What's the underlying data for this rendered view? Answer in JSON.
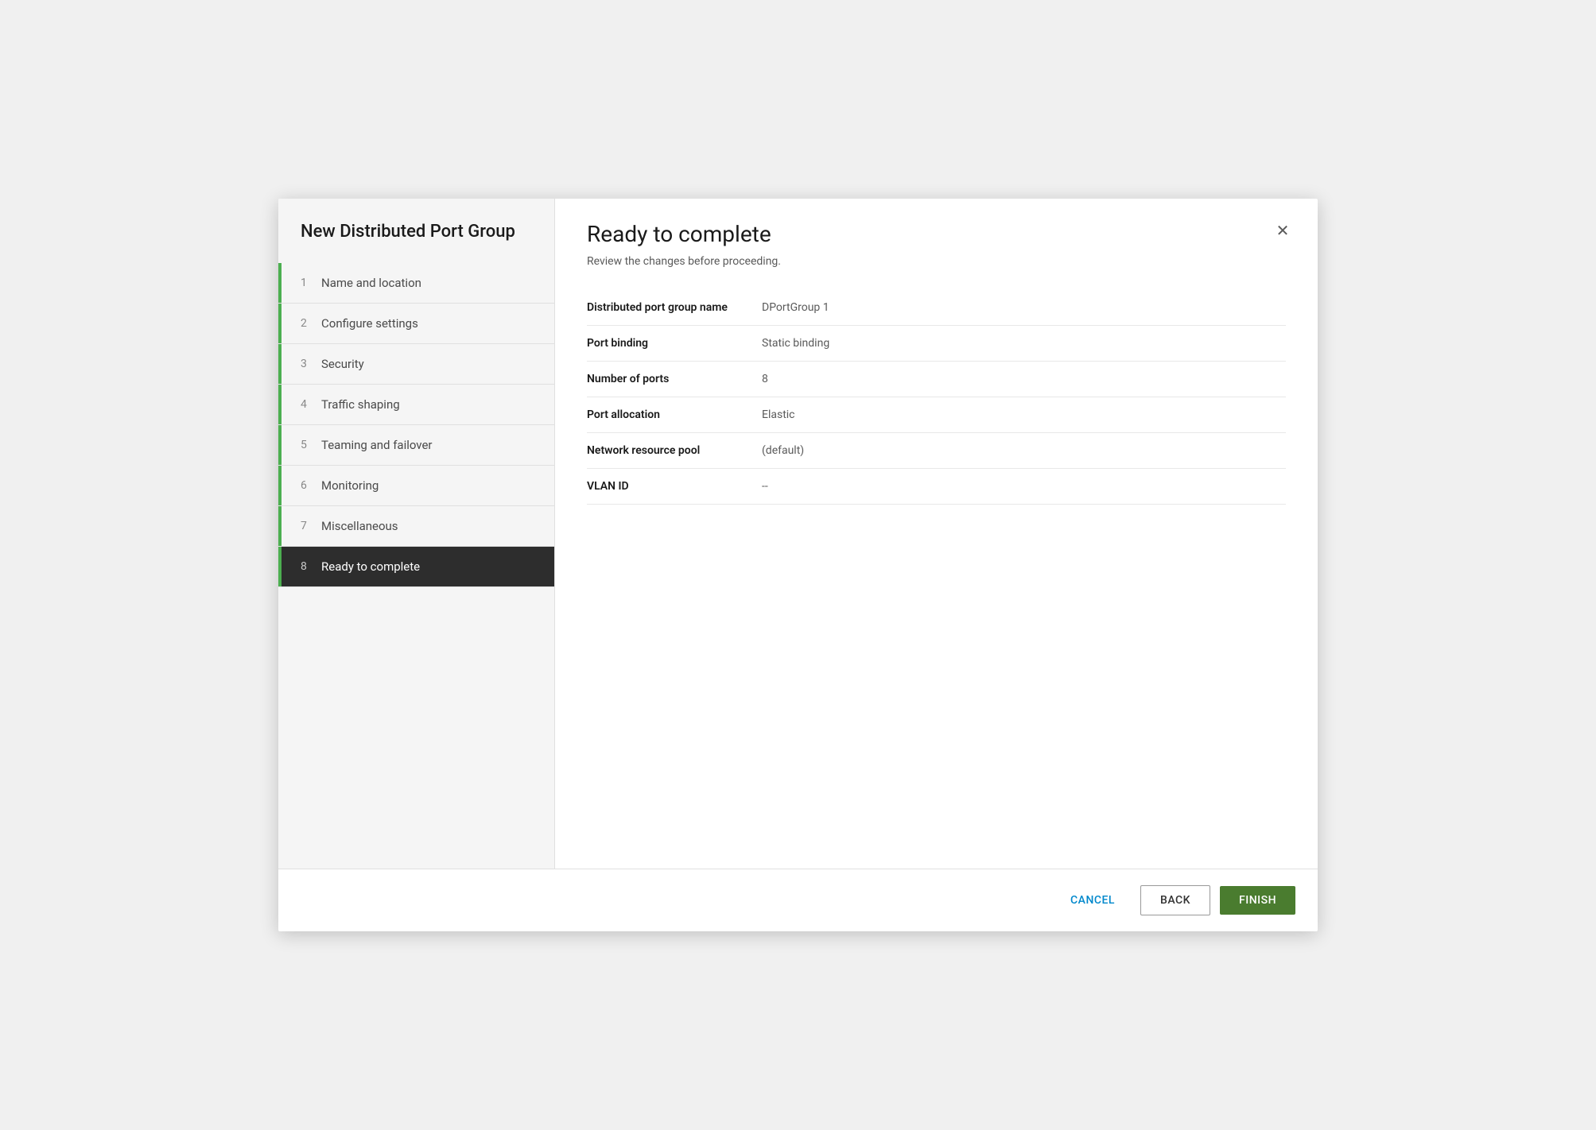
{
  "dialog": {
    "title": "New Distributed Port Group"
  },
  "sidebar": {
    "title": "New Distributed Port Group",
    "steps": [
      {
        "number": "1",
        "label": "Name and location",
        "active": false,
        "indicator": true
      },
      {
        "number": "2",
        "label": "Configure settings",
        "active": false,
        "indicator": true
      },
      {
        "number": "3",
        "label": "Security",
        "active": false,
        "indicator": true
      },
      {
        "number": "4",
        "label": "Traffic shaping",
        "active": false,
        "indicator": true
      },
      {
        "number": "5",
        "label": "Teaming and failover",
        "active": false,
        "indicator": true
      },
      {
        "number": "6",
        "label": "Monitoring",
        "active": false,
        "indicator": true
      },
      {
        "number": "7",
        "label": "Miscellaneous",
        "active": false,
        "indicator": true
      },
      {
        "number": "8",
        "label": "Ready to complete",
        "active": true,
        "indicator": true
      }
    ]
  },
  "content": {
    "heading": "Ready to complete",
    "subtitle": "Review the changes before proceeding.",
    "review_rows": [
      {
        "label": "Distributed port group name",
        "value": "DPortGroup 1"
      },
      {
        "label": "Port binding",
        "value": "Static binding"
      },
      {
        "label": "Number of ports",
        "value": "8"
      },
      {
        "label": "Port allocation",
        "value": "Elastic"
      },
      {
        "label": "Network resource pool",
        "value": "(default)"
      },
      {
        "label": "VLAN ID",
        "value": "--"
      }
    ]
  },
  "footer": {
    "cancel_label": "CANCEL",
    "back_label": "BACK",
    "finish_label": "FINISH"
  },
  "close_icon": "✕"
}
